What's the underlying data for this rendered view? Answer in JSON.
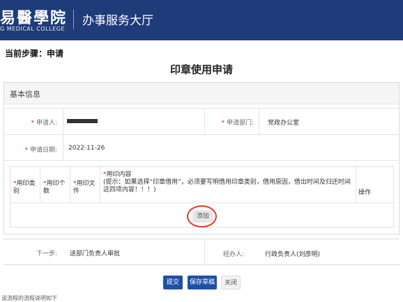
{
  "header": {
    "logo_text": "易醫學院",
    "logo_sub": "G MEDICAL COLLEGE",
    "title": "办事服务大厅"
  },
  "step": {
    "text": "当前步骤：申请"
  },
  "page_title": "印章使用申请",
  "section": {
    "title": "基本信息"
  },
  "form": {
    "applicant": {
      "required_mark": "*",
      "label": "申请人:",
      "value": ""
    },
    "department": {
      "required_mark": "*",
      "label": "申请部门:",
      "value": "党政办公室"
    },
    "date": {
      "required_mark": "*",
      "label": "申请日期:",
      "value": "2022-11-26"
    }
  },
  "seal_table": {
    "headers": [
      {
        "mark": "*",
        "text": "用印类别"
      },
      {
        "mark": "*",
        "text": "用印个数"
      },
      {
        "mark": "*",
        "text": "用印文件"
      },
      {
        "mark": "*",
        "text": "用印内容",
        "hint": "(提示：如果选择“印章借用”，必须要写明借用印章类别，借用原因，借出时间及归还时间这四项内容！！！)"
      }
    ],
    "operation_header": "操作",
    "add_button": "添加"
  },
  "footer": {
    "next_step_label": "下一步:",
    "next_step_value": "送部门负责人审批",
    "handler_label": "经办人:",
    "handler_value": "行政负责人(刘彦明)"
  },
  "buttons": {
    "submit": "提交",
    "save_draft": "保存草稿",
    "close": "关闭"
  },
  "bottom_note": "该流程的流程说明如下",
  "colors": {
    "header_bg": "#1f3b7a",
    "primary": "#2050a6",
    "required": "#e02020",
    "highlight_circle": "#e23a2a"
  }
}
